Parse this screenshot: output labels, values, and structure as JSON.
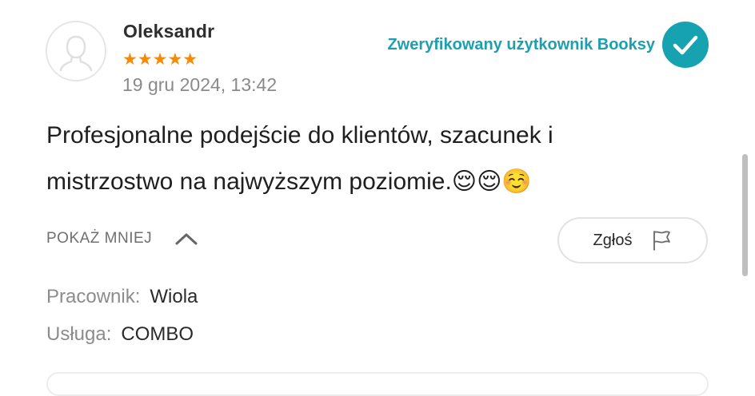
{
  "review": {
    "author_name": "Oleksandr",
    "rating": 5,
    "stars": "★★★★★",
    "date": "19 gru 2024, 13:42",
    "verified_label": "Zweryfikowany użytkownik Booksy",
    "text": "Profesjonalne podejście do klientów, szacunek i mistrzostwo na najwyższym poziomie.😌😌☺️",
    "toggle_label": "POKAŻ MNIEJ",
    "report_label": "Zgłoś",
    "details": {
      "employee_label": "Pracownik:",
      "employee_value": "Wiola",
      "service_label": "Usługa:",
      "service_value": "COMBO"
    }
  },
  "icons": {
    "avatar": "user-placeholder-icon",
    "verified": "check-circle-icon",
    "toggle": "chevron-up-icon",
    "report": "flag-icon"
  },
  "colors": {
    "stars": "#f58a07",
    "verified": "#17a2b1",
    "verified_text": "#1d9fb0",
    "muted_text": "#8a8a8a"
  }
}
